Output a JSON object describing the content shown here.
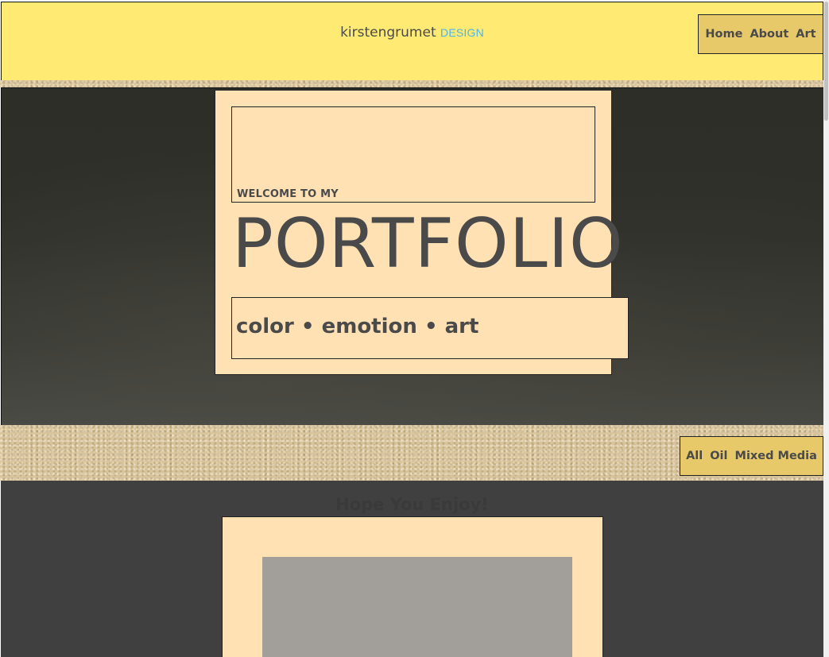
{
  "header": {
    "brand_name": "kirstengrumet",
    "brand_suffix": "DESIGN",
    "nav": [
      "Home",
      "About",
      "Art"
    ]
  },
  "hero": {
    "welcome": "WELCOME TO MY",
    "title": "PORTFOLIO",
    "tagline": "color • emotion • art"
  },
  "filter": {
    "items": [
      "All",
      "Oil",
      "Mixed Media"
    ]
  },
  "gallery": {
    "heading": "Hope You Enjoy!"
  },
  "colors": {
    "header_bg": "#ffeb74",
    "nav_bg": "#e8c96a",
    "card_bg": "#ffe1b3",
    "text": "#4a4a4a",
    "accent": "#4fb3e8",
    "hero_bg": "#2f302a",
    "gallery_bg": "#404040"
  }
}
